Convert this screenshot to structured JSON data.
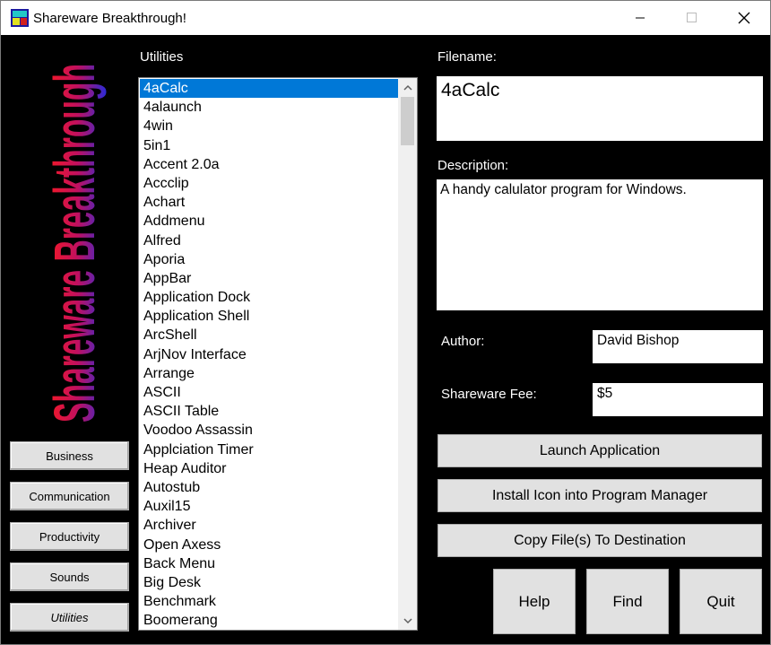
{
  "window": {
    "title": "Shareware Breakthrough!"
  },
  "banner": {
    "text": "Shareware Breakthrough"
  },
  "categories": [
    {
      "label": "Business",
      "active": false
    },
    {
      "label": "Communication",
      "active": false
    },
    {
      "label": "Productivity",
      "active": false
    },
    {
      "label": "Sounds",
      "active": false
    },
    {
      "label": "Utilities",
      "active": true
    }
  ],
  "list": {
    "heading": "Utilities",
    "selected": "4aCalc",
    "items": [
      "4aCalc",
      "4alaunch",
      "4win",
      "5in1",
      "Accent 2.0a",
      "Accclip",
      "Achart",
      "Addmenu",
      "Alfred",
      "Aporia",
      "AppBar",
      "Application Dock",
      "Application Shell",
      "ArcShell",
      "ArjNov Interface",
      "Arrange",
      "ASCII",
      "ASCII Table",
      "Voodoo Assassin",
      "Applciation Timer",
      "Heap Auditor",
      "Autostub",
      "Auxil15",
      "Archiver",
      "Open Axess",
      "Back Menu",
      "Big Desk",
      "Benchmark",
      "Boomerang"
    ]
  },
  "details": {
    "filename_label": "Filename:",
    "filename": "4aCalc",
    "description_label": "Description:",
    "description": "A handy calulator program for Windows.",
    "author_label": "Author:",
    "author": "David Bishop",
    "fee_label": "Shareware Fee:",
    "fee": "$5"
  },
  "actions": {
    "launch": "Launch Application",
    "install": "Install Icon into Program Manager",
    "copy": "Copy File(s) To Destination",
    "help": "Help",
    "find": "Find",
    "quit": "Quit"
  },
  "icons": {
    "app": "app-logo-icon",
    "minimize": "minimize-icon",
    "maximize": "maximize-icon",
    "close": "close-icon",
    "scroll_up": "chevron-up-icon",
    "scroll_down": "chevron-down-icon"
  },
  "colors": {
    "selection": "#0078d7",
    "banner_top": "#ff1a1a",
    "banner_bottom": "#2a2ad8"
  }
}
